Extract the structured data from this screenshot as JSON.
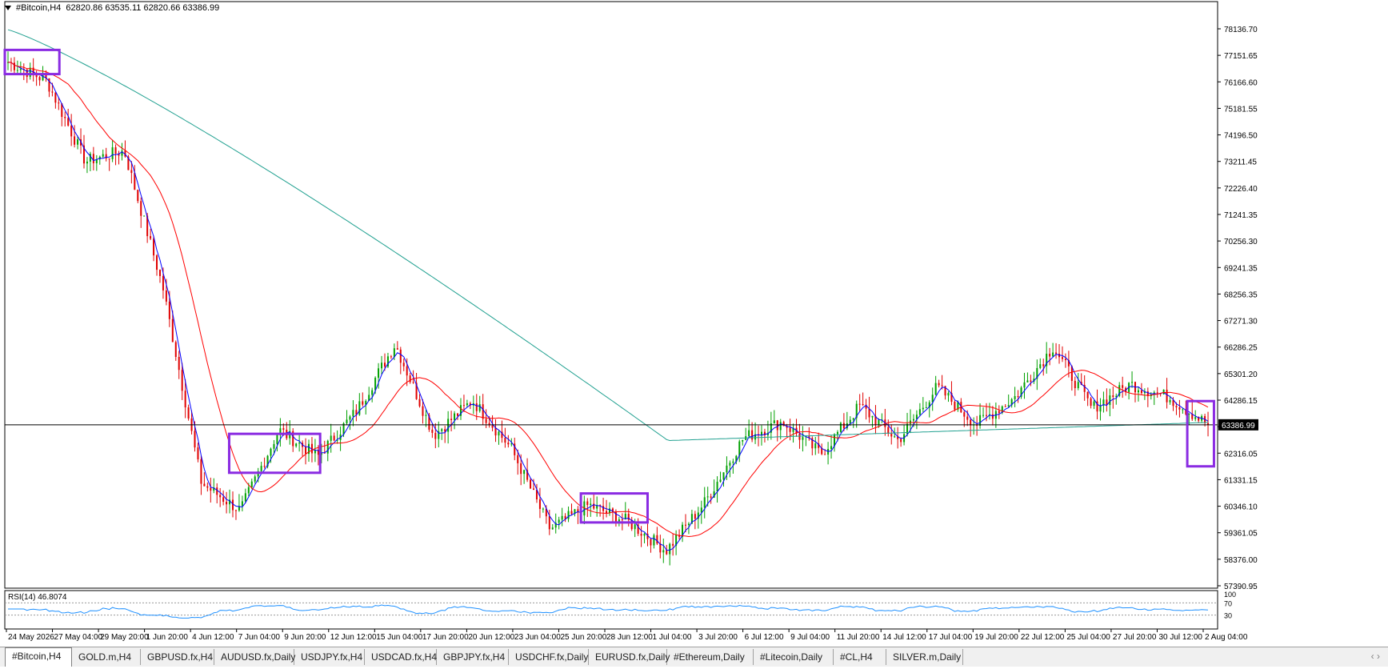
{
  "header": {
    "symbol": "#Bitcoin,H4",
    "ohlc": "62820.86 63535.11 62820.66 63386.99"
  },
  "rsi": {
    "label": "RSI(14) 46.8074",
    "levels": [
      "100",
      "70",
      "30"
    ]
  },
  "price_axis": [
    "78136.70",
    "77151.65",
    "76166.60",
    "75181.55",
    "74196.50",
    "73211.45",
    "72226.40",
    "71241.35",
    "70256.30",
    "69241.35",
    "68256.35",
    "67271.30",
    "66286.25",
    "65301.20",
    "64286.15",
    "63301.10",
    "62316.05",
    "61331.15",
    "60346.10",
    "59361.05",
    "58376.00",
    "57390.95"
  ],
  "current_price": "63386.99",
  "time_axis": [
    "24 May 2026",
    "27 May 04:00",
    "29 May 20:00",
    "1 Jun 20:00",
    "4 Jun 12:00",
    "7 Jun 04:00",
    "9 Jun 20:00",
    "12 Jun 12:00",
    "15 Jun 04:00",
    "17 Jun 20:00",
    "20 Jun 12:00",
    "23 Jun 04:00",
    "25 Jun 20:00",
    "28 Jun 12:00",
    "1 Jul 04:00",
    "3 Jul 20:00",
    "6 Jul 12:00",
    "9 Jul 04:00",
    "11 Jul 20:00",
    "14 Jul 12:00",
    "17 Jul 04:00",
    "19 Jul 20:00",
    "22 Jul 12:00",
    "25 Jul 04:00",
    "27 Jul 20:00",
    "30 Jul 12:00",
    "2 Aug 04:00"
  ],
  "tabs": [
    "#Bitcoin,H4",
    "GOLD.m,H4",
    "GBPUSD.fx,H4",
    "AUDUSD.fx,Daily",
    "USDJPY.fx,H4",
    "USDCAD.fx,H4",
    "GBPJPY.fx,H4",
    "USDCHF.fx,Daily",
    "EURUSD.fx,Daily",
    "#Ethereum,Daily",
    "#Litecoin,Daily",
    "#CL,H4",
    "SILVER.m,Daily"
  ],
  "tab_arrows": "‹ ›",
  "colors": {
    "up": "#00a000",
    "down": "#e00000",
    "fast_ma": "#0000ff",
    "mid_ma": "#ff0000",
    "slow_ma": "#20a090",
    "rsi": "#1e90ff",
    "box": "#8a2be2"
  },
  "chart_data": {
    "type": "candlestick",
    "symbol": "#Bitcoin",
    "timeframe": "H4",
    "price_range": [
      57390.95,
      78136.7
    ],
    "rsi_range": [
      0,
      100
    ],
    "rsi_levels": [
      70,
      30
    ],
    "rsi_last": 46.8074,
    "last_close": 63386.99,
    "key_closes": [
      {
        "t": "24 May 2026",
        "price": 76900
      },
      {
        "t": "27 May 04:00",
        "price": 76200
      },
      {
        "t": "28 May 12:00",
        "price": 73200
      },
      {
        "t": "29 May 20:00",
        "price": 73600
      },
      {
        "t": "1 Jun 20:00",
        "price": 68500
      },
      {
        "t": "4 Jun 12:00",
        "price": 61200
      },
      {
        "t": "5 Jun 04:00",
        "price": 60200
      },
      {
        "t": "7 Jun 04:00",
        "price": 63200
      },
      {
        "t": "9 Jun 20:00",
        "price": 62200
      },
      {
        "t": "12 Jun 12:00",
        "price": 63900
      },
      {
        "t": "15 Jun 04:00",
        "price": 66400
      },
      {
        "t": "17 Jun 20:00",
        "price": 63000
      },
      {
        "t": "20 Jun 12:00",
        "price": 64300
      },
      {
        "t": "23 Jun 04:00",
        "price": 62500
      },
      {
        "t": "24 Jun 12:00",
        "price": 59500
      },
      {
        "t": "25 Jun 20:00",
        "price": 60400
      },
      {
        "t": "28 Jun 12:00",
        "price": 59800
      },
      {
        "t": "29 Jun 12:00",
        "price": 58700
      },
      {
        "t": "1 Jul 04:00",
        "price": 60500
      },
      {
        "t": "3 Jul 20:00",
        "price": 62900
      },
      {
        "t": "6 Jul 12:00",
        "price": 63500
      },
      {
        "t": "7 Jul 12:00",
        "price": 62300
      },
      {
        "t": "9 Jul 04:00",
        "price": 64100
      },
      {
        "t": "11 Jul 20:00",
        "price": 62800
      },
      {
        "t": "14 Jul 12:00",
        "price": 64800
      },
      {
        "t": "17 Jul 04:00",
        "price": 63400
      },
      {
        "t": "19 Jul 20:00",
        "price": 64400
      },
      {
        "t": "22 Jul 12:00",
        "price": 66300
      },
      {
        "t": "25 Jul 04:00",
        "price": 64000
      },
      {
        "t": "27 Jul 20:00",
        "price": 64900
      },
      {
        "t": "30 Jul 12:00",
        "price": 64400
      },
      {
        "t": "2 Aug 04:00",
        "price": 63386.99
      }
    ],
    "boxes_marked": [
      {
        "from": "24 May 2026",
        "to": "27 May 04:00",
        "price_range": [
          76450,
          77350
        ]
      },
      {
        "from": "6 Jun 20:00",
        "to": "10 Jun 12:00",
        "price_range": [
          61600,
          63050
        ]
      },
      {
        "from": "25 Jun 04:00",
        "to": "28 Jun 20:00",
        "price_range": [
          59750,
          60830
        ]
      },
      {
        "from": "1 Aug 12:00",
        "to": "2 Aug 04:00",
        "price_range": [
          61840,
          64270
        ]
      }
    ]
  }
}
